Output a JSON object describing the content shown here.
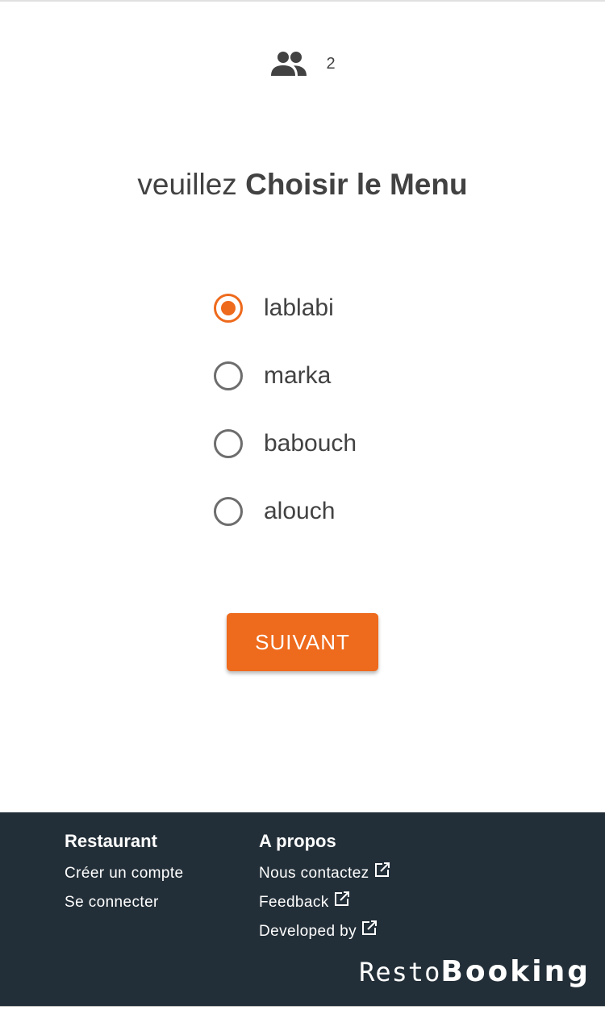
{
  "header": {
    "guests_icon": "people-icon",
    "guest_count": "2"
  },
  "title": {
    "prefix": "veuillez",
    "emphasis": "Choisir le Menu"
  },
  "menu": {
    "options": [
      {
        "label": "lablabi",
        "selected": true
      },
      {
        "label": "marka",
        "selected": false
      },
      {
        "label": "babouch",
        "selected": false
      },
      {
        "label": "alouch",
        "selected": false
      }
    ]
  },
  "actions": {
    "next_label": "SUIVANT"
  },
  "footer": {
    "col1": {
      "title": "Restaurant",
      "links": [
        "Créer un compte",
        "Se connecter"
      ]
    },
    "col2": {
      "title": "A propos",
      "links": [
        "Nous contactez",
        "Feedback",
        "Developed by"
      ]
    },
    "external_icon": "external-link-icon",
    "logo_light": "Resto",
    "logo_bold": "Booking"
  },
  "colors": {
    "accent": "#ee6a1c",
    "footer_bg": "#232f38",
    "text": "#424242"
  }
}
